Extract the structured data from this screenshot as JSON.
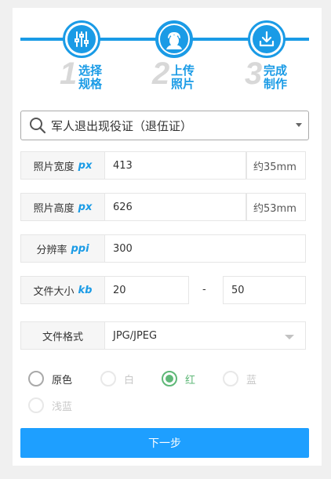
{
  "steps": [
    {
      "num": "1",
      "label": "选择规格",
      "line1": "选择",
      "line2": "规格",
      "icon": "sliders-icon"
    },
    {
      "num": "2",
      "label": "上传照片",
      "line1": "上传",
      "line2": "照片",
      "icon": "portrait-icon"
    },
    {
      "num": "3",
      "label": "完成制作",
      "line1": "完成",
      "line2": "制作",
      "icon": "download-icon"
    }
  ],
  "spec_select": {
    "value": "军人退出现役证（退伍证）",
    "icon": "search-icon"
  },
  "width_row": {
    "label": "照片宽度",
    "unit": "px",
    "value": "413",
    "suffix": "约35mm"
  },
  "height_row": {
    "label": "照片高度",
    "unit": "px",
    "value": "626",
    "suffix": "约53mm"
  },
  "dpi_row": {
    "label": "分辨率",
    "unit": "ppi",
    "value": "300"
  },
  "size_row": {
    "label": "文件大小",
    "unit": "kb",
    "min": "20",
    "separator": "-",
    "max": "50"
  },
  "format_row": {
    "label": "文件格式",
    "value": "JPG/JPEG"
  },
  "colors": [
    {
      "label": "原色",
      "state": "enabled"
    },
    {
      "label": "白",
      "state": "disabled"
    },
    {
      "label": "红",
      "state": "checked"
    },
    {
      "label": "蓝",
      "state": "disabled"
    },
    {
      "label": "浅蓝",
      "state": "disabled"
    }
  ],
  "next_button": {
    "label": "下一步"
  },
  "theme": {
    "accent": "#1a9be6",
    "button": "#1e9fff",
    "checked": "#5fb878"
  }
}
